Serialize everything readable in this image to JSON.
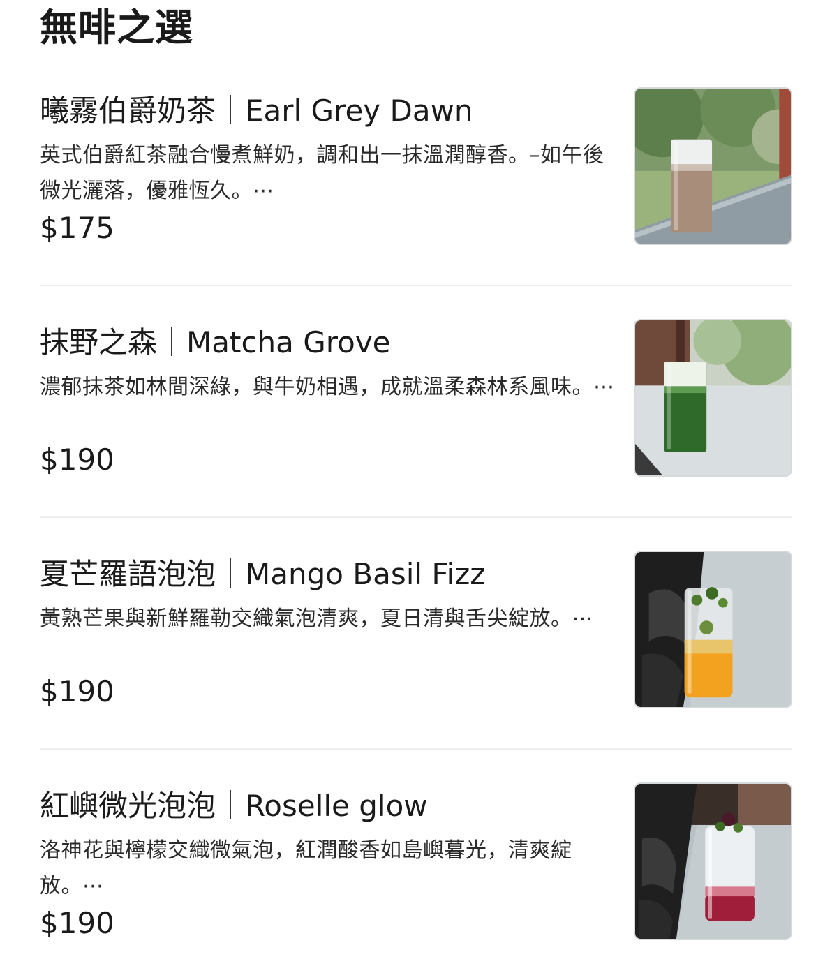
{
  "section": {
    "title": "無啡之選"
  },
  "items": [
    {
      "name": "曦霧伯爵奶茶｜Earl Grey Dawn",
      "description": "英式伯爵紅茶融合慢煮鮮奶，調和出一抹溫潤醇香。–如午後微光灑落，優雅恆久。⋯",
      "price": "$175",
      "image_icon": "earl-grey-milk-tea-photo"
    },
    {
      "name": "抹野之森｜Matcha Grove",
      "description": "濃郁抹茶如林間深綠，與牛奶相遇，成就溫柔森林系風味。⋯",
      "price": "$190",
      "image_icon": "matcha-latte-photo"
    },
    {
      "name": "夏芒羅語泡泡｜Mango Basil Fizz",
      "description": "黃熟芒果與新鮮羅勒交織氣泡清爽，夏日清與舌尖綻放。⋯",
      "price": "$190",
      "image_icon": "mango-basil-fizz-photo"
    },
    {
      "name": "紅嶼微光泡泡｜Roselle glow",
      "description": "洛神花與檸檬交織微氣泡，紅潤酸香如島嶼暮光，清爽綻放。⋯",
      "price": "$190",
      "image_icon": "roselle-glow-photo"
    }
  ]
}
